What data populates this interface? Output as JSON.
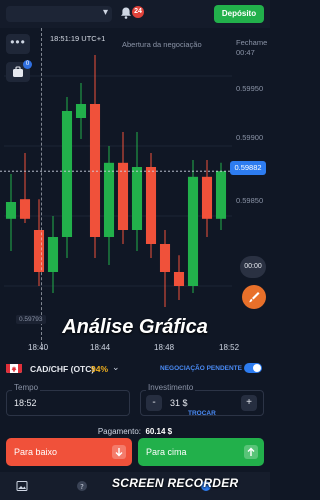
{
  "header": {
    "notification_count": "24",
    "deposit_label": "Depósito"
  },
  "chart_overlay": {
    "timer": "18:51:19",
    "timer_suffix": "UTC+1",
    "open_label": "Abertura da negociação",
    "close_title": "Fechame",
    "close_time": "00:47",
    "current_price": "0.59882",
    "low_price": "0.59793",
    "countdown": "00:00",
    "watermark": "Análise Gráfica"
  },
  "price_ticks": [
    "0.59950",
    "0.59900",
    "0.59850"
  ],
  "time_ticks": [
    "18:40",
    "18:44",
    "18:48",
    "18:52"
  ],
  "asset": {
    "name": "CAD/CHF (OTC)",
    "payout": "94%",
    "pending_label": "NEGOCIAÇÃO PENDENTE"
  },
  "trade_form": {
    "time_label": "Tempo",
    "time_value": "18:52",
    "invest_label": "Investimento",
    "invest_value": "31 $",
    "minus": "-",
    "plus": "+",
    "switch_label": "TROCAR",
    "payment_label": "Pagamento:",
    "payment_value": "60.14 $"
  },
  "buttons": {
    "down": "Para baixo",
    "up": "Para cima"
  },
  "recorder_watermark": "SCREEN RECORDER",
  "colors": {
    "bull": "#22b04b",
    "bear": "#f0513a",
    "accent": "#2d7cf0",
    "payout": "#f2b01e"
  },
  "chart_data": {
    "type": "candlestick",
    "ylim": [
      0.5977,
      0.5997
    ],
    "candles": [
      {
        "o": 0.59848,
        "h": 0.5988,
        "l": 0.59825,
        "c": 0.5986
      },
      {
        "o": 0.59862,
        "h": 0.59895,
        "l": 0.59845,
        "c": 0.59848
      },
      {
        "o": 0.5984,
        "h": 0.59862,
        "l": 0.598,
        "c": 0.5981
      },
      {
        "o": 0.5981,
        "h": 0.5985,
        "l": 0.59795,
        "c": 0.59835
      },
      {
        "o": 0.59835,
        "h": 0.59935,
        "l": 0.5982,
        "c": 0.59925
      },
      {
        "o": 0.5992,
        "h": 0.59945,
        "l": 0.59905,
        "c": 0.5993
      },
      {
        "o": 0.5993,
        "h": 0.59965,
        "l": 0.5982,
        "c": 0.59835
      },
      {
        "o": 0.59835,
        "h": 0.599,
        "l": 0.59815,
        "c": 0.59888
      },
      {
        "o": 0.59888,
        "h": 0.5991,
        "l": 0.5983,
        "c": 0.5984
      },
      {
        "o": 0.5984,
        "h": 0.5991,
        "l": 0.59825,
        "c": 0.59885
      },
      {
        "o": 0.59885,
        "h": 0.59895,
        "l": 0.5982,
        "c": 0.5983
      },
      {
        "o": 0.5983,
        "h": 0.5984,
        "l": 0.59785,
        "c": 0.5981
      },
      {
        "o": 0.5981,
        "h": 0.59822,
        "l": 0.5979,
        "c": 0.598
      },
      {
        "o": 0.598,
        "h": 0.5989,
        "l": 0.59795,
        "c": 0.59878
      },
      {
        "o": 0.59878,
        "h": 0.5989,
        "l": 0.59835,
        "c": 0.59848
      },
      {
        "o": 0.59848,
        "h": 0.59888,
        "l": 0.5984,
        "c": 0.59882
      }
    ]
  }
}
